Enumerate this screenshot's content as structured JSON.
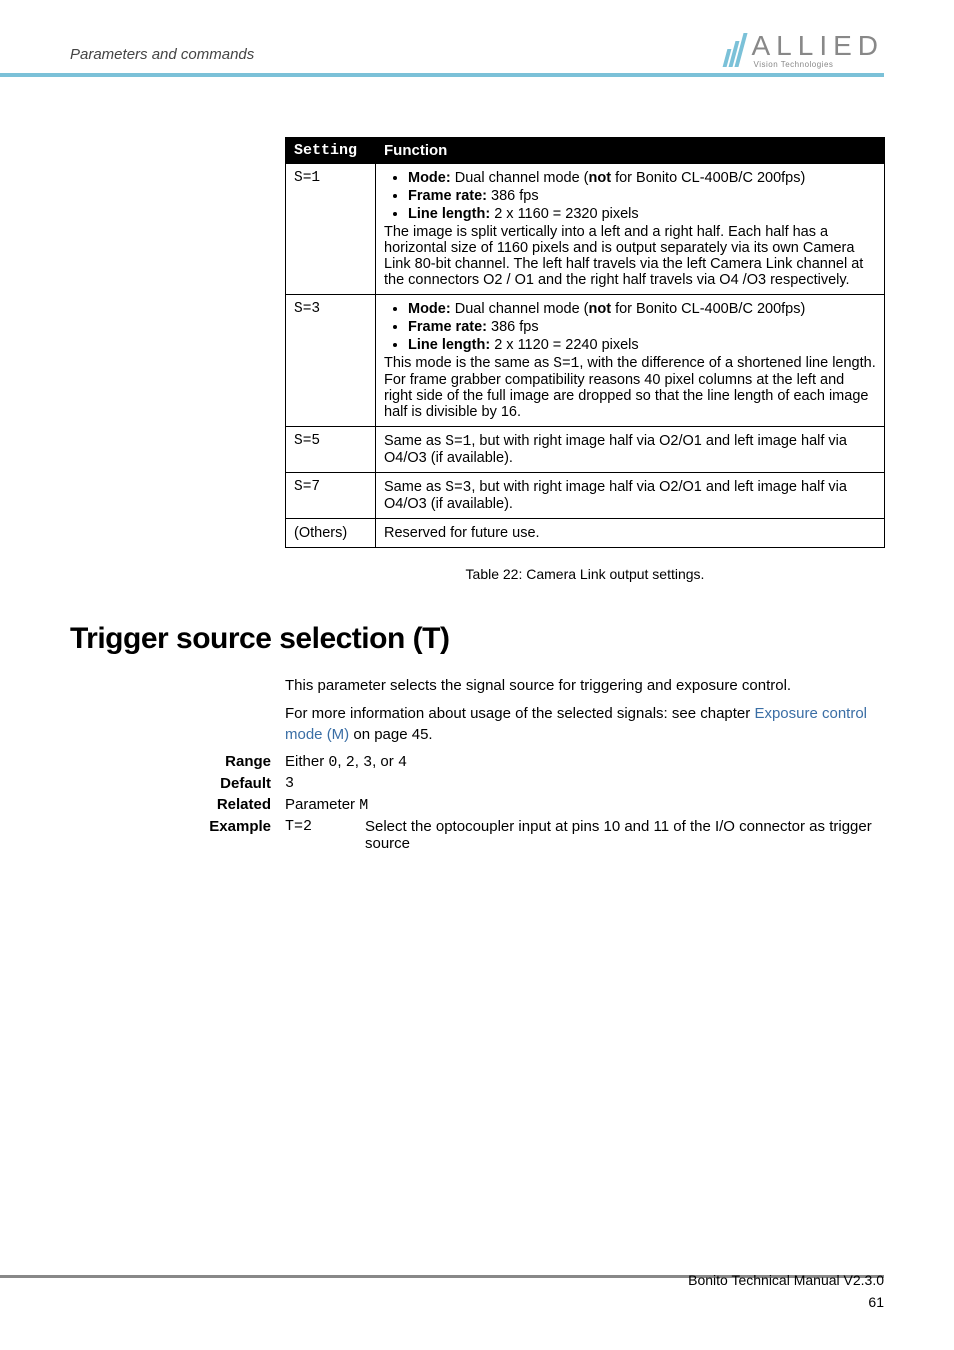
{
  "header": {
    "section": "Parameters and commands",
    "logo_main": "ALLIED",
    "logo_sub": "Vision Technologies"
  },
  "table": {
    "col_setting": "Setting",
    "col_function": "Function",
    "s1": {
      "setting": "S=1",
      "mode_label": "Mode:",
      "mode_text_a": " Dual channel mode (",
      "mode_not": "not",
      "mode_text_b": " for Bonito CL-400B/C 200fps)",
      "frame_label": "Frame rate:",
      "frame_text": " 386 fps",
      "line_label": "Line length:",
      "line_text": " 2 x 1160 = 2320 pixels",
      "body": "The image is split vertically into a left and a right half. Each half has a horizontal size of 1160 pixels and is output separately via its own Camera Link 80-bit channel. The left half travels via the left Camera Link channel at the connectors O2 / O1 and the right half travels via O4 /O3 respectively."
    },
    "s3": {
      "setting": "S=3",
      "mode_label": "Mode:",
      "mode_text_a": " Dual channel mode (",
      "mode_not": "not",
      "mode_text_b": " for Bonito CL-400B/C 200fps)",
      "frame_label": "Frame rate:",
      "frame_text": " 386 fps",
      "line_label": "Line length:",
      "line_text": " 2 x 1120 = 2240 pixels",
      "body_a": "This mode is the same as ",
      "body_mono": "S=1",
      "body_b": ", with the difference of a shortened line length. For frame grabber compatibility reasons 40 pixel columns at the left and right side of the full image are dropped so that the line length of each image half is divisible by 16."
    },
    "s5": {
      "setting": "S=5",
      "text_a": "Same as ",
      "mono": "S=1",
      "text_b": ", but with right image half via O2/O1 and left image half via O4/O3 (if available)."
    },
    "s7": {
      "setting": "S=7",
      "text_a": "Same as ",
      "mono": "S=3",
      "text_b": ", but with right image half via O2/O1 and left image half via O4/O3 (if available)."
    },
    "others": {
      "setting": "(Others)",
      "text": "Reserved for future use."
    },
    "caption": "Table 22: Camera Link output settings."
  },
  "section_title": "Trigger source selection (T)",
  "intro": {
    "p1": "This parameter selects the signal source for triggering and exposure control.",
    "p2a": "For more information about usage of the selected signals: see chapter ",
    "p2link": "Exposure control mode (M)",
    "p2b": " on page 45."
  },
  "params": {
    "range_label": "Range",
    "range_a": "Either ",
    "range_v0": "0",
    "range_c1": ", ",
    "range_v2": "2",
    "range_c2": ", ",
    "range_v3": "3",
    "range_c3": ", or ",
    "range_v4": "4",
    "default_label": "Default",
    "default_value": "3",
    "related_label": "Related",
    "related_a": "Parameter ",
    "related_mono": "M",
    "example_label": "Example",
    "example_key": "T=2",
    "example_text": "Select the optocoupler input at pins 10 and 11 of the I/O connector as trigger source"
  },
  "footer": {
    "doc": "Bonito Technical Manual V2.3.0",
    "page": "61"
  }
}
